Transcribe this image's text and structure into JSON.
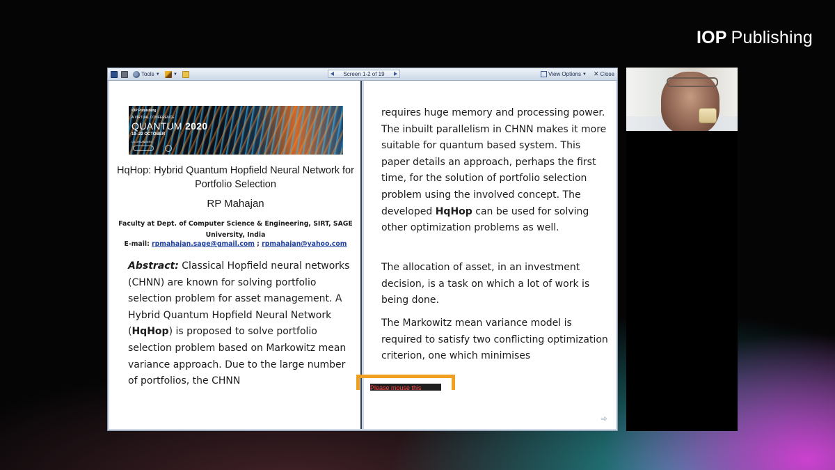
{
  "brand": {
    "bold": "IOP",
    "rest": "Publishing"
  },
  "toolbar": {
    "tools_label": "Tools",
    "screen_label": "Screen 1-2 of 19",
    "view_options_label": "View Options",
    "close_label": "Close"
  },
  "left_page": {
    "banner": {
      "publisher": "IOP Publishing",
      "virtual": "A VIRTUAL CONFERENCE",
      "title_word": "QUANTUM",
      "year": "2020",
      "dates": "19–22 OCTOBER",
      "coorganisers": "CO-ORGANISERS"
    },
    "title": "HqHop: Hybrid Quantum Hopfield Neural Network for Portfolio Selection",
    "author": "RP Mahajan",
    "affiliation": "Faculty at Dept. of Computer Science & Engineering, SIRT, SAGE University, India",
    "email_label": "E-mail:",
    "email_1": "rpmahajan.sage@gmail.com",
    "email_sep": ";",
    "email_2": "rpmahajan@yahoo.com",
    "abstract_label": "Abstract:",
    "abstract_part1": "Classical Hopfield neural networks (CHNN) are known for solving portfolio selection problem for asset management. A Hybrid Quantum Hopfield Neural Network (",
    "abstract_bold": "HqHop",
    "abstract_part2": ") is proposed to solve portfolio selection problem based on Markowitz mean variance approach. Due to the large number of portfolios, the CHNN"
  },
  "right_page": {
    "p1_part1": "requires huge memory and processing power. The inbuilt parallelism in CHNN makes it more suitable for quantum based system. This paper details an approach, perhaps the first time, for the solution of portfolio selection problem using the involved concept. The developed ",
    "p1_bold": "HqHop",
    "p1_part2": " can be used for solving other optimization problems as well.",
    "p2": "The allocation of asset, in an investment decision, is a task on which a lot of work is being done.",
    "p3": "The Markowitz mean variance model is required to satisfy two conflicting optimization criterion, one which minimises"
  },
  "overlay": {
    "highlight_text": "Please mouse this"
  },
  "colors": {
    "highlight": "#f0a020",
    "link": "#1d3fa0",
    "page_divider": "#2d3d5a"
  }
}
